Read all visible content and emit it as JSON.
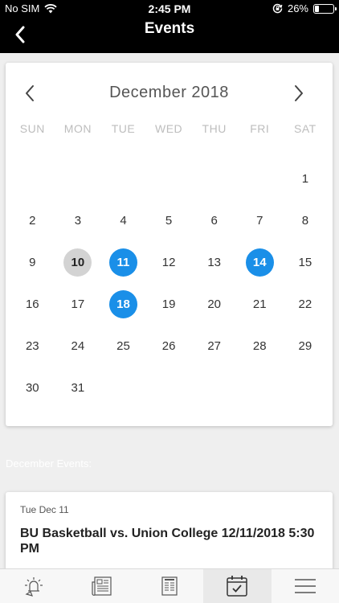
{
  "status_bar": {
    "carrier": "No SIM",
    "time": "2:45 PM",
    "battery_text": "26%",
    "battery_level": 0.26
  },
  "nav": {
    "title": "Events"
  },
  "calendar": {
    "month_title": "December 2018",
    "weekdays": [
      "SUN",
      "MON",
      "TUE",
      "WED",
      "THU",
      "FRI",
      "SAT"
    ],
    "leading_blanks": 6,
    "days": [
      "1",
      "2",
      "3",
      "4",
      "5",
      "6",
      "7",
      "8",
      "9",
      "10",
      "11",
      "12",
      "13",
      "14",
      "15",
      "16",
      "17",
      "18",
      "19",
      "20",
      "21",
      "22",
      "23",
      "24",
      "25",
      "26",
      "27",
      "28",
      "29",
      "30",
      "31"
    ],
    "today": "10",
    "event_days": [
      "11",
      "14",
      "18"
    ],
    "colors": {
      "event": "#1a8fe8",
      "today": "#d3d3d3"
    }
  },
  "events_section": {
    "label": "December Events:"
  },
  "events": [
    {
      "date": "Tue Dec 11",
      "title": "BU Basketball vs. Union College 12/11/2018 5:30 PM"
    }
  ],
  "tab_bar": {
    "tabs": [
      {
        "icon": "alert-bell-icon",
        "active": false
      },
      {
        "icon": "news-icon",
        "active": false
      },
      {
        "icon": "newspaper-icon",
        "active": false
      },
      {
        "icon": "calendar-check-icon",
        "active": true
      },
      {
        "icon": "menu-icon",
        "active": false
      }
    ]
  }
}
